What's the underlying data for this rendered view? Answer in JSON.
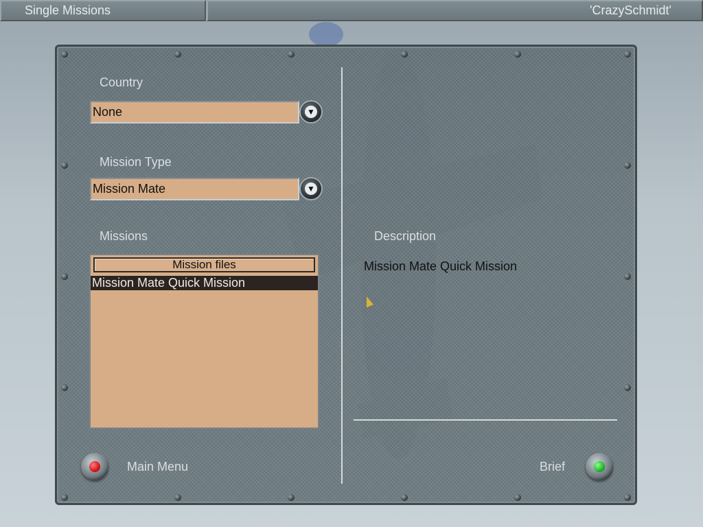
{
  "header": {
    "screen_title": "Single Missions",
    "pilot_name": "'CrazySchmidt'"
  },
  "country": {
    "label": "Country",
    "value": "None"
  },
  "mission_type": {
    "label": "Mission Type",
    "value": "Mission Mate"
  },
  "missions": {
    "label": "Missions",
    "column_header": "Mission files",
    "items": [
      "Mission Mate Quick Mission"
    ]
  },
  "description": {
    "label": "Description",
    "text": "Mission Mate Quick Mission"
  },
  "footer": {
    "main_menu_label": "Main Menu",
    "brief_label": "Brief"
  },
  "colors": {
    "main_menu_lamp": "#d8151b",
    "brief_lamp": "#1fb82a",
    "field_bg": "#d7ad87"
  }
}
